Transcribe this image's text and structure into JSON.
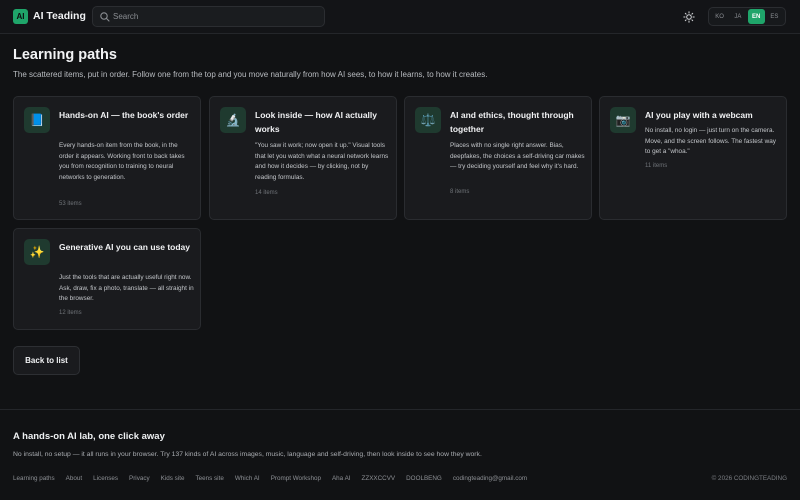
{
  "header": {
    "logo_badge": "AI",
    "logo_text": "AI Teading",
    "search": {
      "placeholder": "Search",
      "value": ""
    },
    "theme_icon": "sun-icon",
    "languages": [
      {
        "code": "KO",
        "active": false
      },
      {
        "code": "JA",
        "active": false
      },
      {
        "code": "EN",
        "active": true
      },
      {
        "code": "ES",
        "active": false
      }
    ]
  },
  "main": {
    "title": "Learning paths",
    "subtitle": "The scattered items, put in order. Follow one from the top and you move naturally from how AI sees, to how it learns, to how it creates.",
    "cards": [
      {
        "icon": "📘",
        "icon_name": "book-icon",
        "title": "Hands-on AI — the book's order",
        "desc": "Every hands-on item from the book, in the order it appears. Working front to back takes you from recognition to training to neural networks to generation.",
        "count": "53 items"
      },
      {
        "icon": "🔬",
        "icon_name": "microscope-icon",
        "title": "Look inside — how AI actually works",
        "desc": "\"You saw it work; now open it up.\" Visual tools that let you watch what a neural network learns and how it decides — by clicking, not by reading formulas.",
        "count": "14 items"
      },
      {
        "icon": "⚖️",
        "icon_name": "scales-icon",
        "title": "AI and ethics, thought through together",
        "desc": "Places with no single right answer. Bias, deepfakes, the choices a self-driving car makes — try deciding yourself and feel why it's hard.",
        "count": "8 items"
      },
      {
        "icon": "📷",
        "icon_name": "camera-icon",
        "title": "AI you play with a webcam",
        "desc": "No install, no login — just turn on the camera. Move, and the screen follows. The fastest way to get a \"whoa.\"",
        "count": "11 items"
      },
      {
        "icon": "✨",
        "icon_name": "sparkles-icon",
        "title": "Generative AI you can use today",
        "desc": "Just the tools that are actually useful right now. Ask, draw, fix a photo, translate — all straight in the browser.",
        "count": "12 items"
      }
    ],
    "back_label": "Back to list"
  },
  "footer": {
    "title": "A hands-on AI lab, one click away",
    "desc": "No install, no setup — it all runs in your browser. Try 137 kinds of AI across images, music, language and self-driving, then look inside to see how they work.",
    "links": [
      "Learning paths",
      "About",
      "Licenses",
      "Privacy",
      "Kids site",
      "Teens site",
      "Which AI",
      "Prompt Workshop",
      "Aha AI",
      "ZZXXCCVV",
      "DOOLBENG",
      "codingteading@gmail.com"
    ],
    "copyright": "© 2026 CODINGTEADING"
  }
}
